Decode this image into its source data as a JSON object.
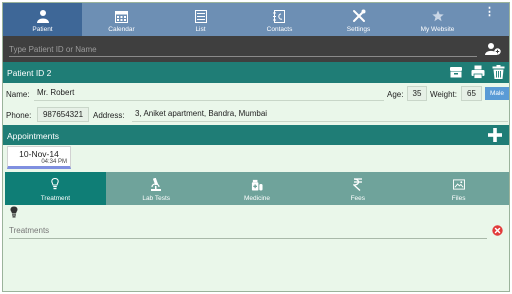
{
  "nav": {
    "items": [
      {
        "label": "Patient",
        "icon": "patient-icon",
        "active": true
      },
      {
        "label": "Calendar",
        "icon": "calendar-icon",
        "active": false
      },
      {
        "label": "List",
        "icon": "list-icon",
        "active": false
      },
      {
        "label": "Contacts",
        "icon": "contacts-icon",
        "active": false
      },
      {
        "label": "Settings",
        "icon": "settings-icon",
        "active": false
      },
      {
        "label": "My Website",
        "icon": "star-icon",
        "active": false
      }
    ],
    "more": "⋮"
  },
  "search": {
    "placeholder": "Type Patient ID or Name"
  },
  "patient": {
    "title": "Patient ID 2",
    "name_label": "Name:",
    "name": "Mr. Robert",
    "age_label": "Age:",
    "age": "35",
    "weight_label": "Weight:",
    "weight": "65",
    "gender": "Male",
    "phone_label": "Phone:",
    "phone": "987654321",
    "address_label": "Address:",
    "address": "3, Aniket apartment, Bandra, Mumbai"
  },
  "appointments": {
    "title": "Appointments",
    "items": [
      {
        "date": "10-Nov-14",
        "time": "04:34 PM"
      }
    ]
  },
  "tabs": [
    {
      "label": "Treatment",
      "icon": "treatment-icon",
      "active": true
    },
    {
      "label": "Lab Tests",
      "icon": "microscope-icon",
      "active": false
    },
    {
      "label": "Medicine",
      "icon": "medicine-icon",
      "active": false
    },
    {
      "label": "Fees",
      "icon": "rupee-icon",
      "active": false
    },
    {
      "label": "Files",
      "icon": "files-icon",
      "active": false
    }
  ],
  "treatments": {
    "placeholder": "Treatments"
  },
  "colors": {
    "nav": "#6d8fb4",
    "nav_active": "#3e6797",
    "teal": "#1f7d76",
    "tab": "#6fa39b",
    "background": "#eaf7ea"
  }
}
